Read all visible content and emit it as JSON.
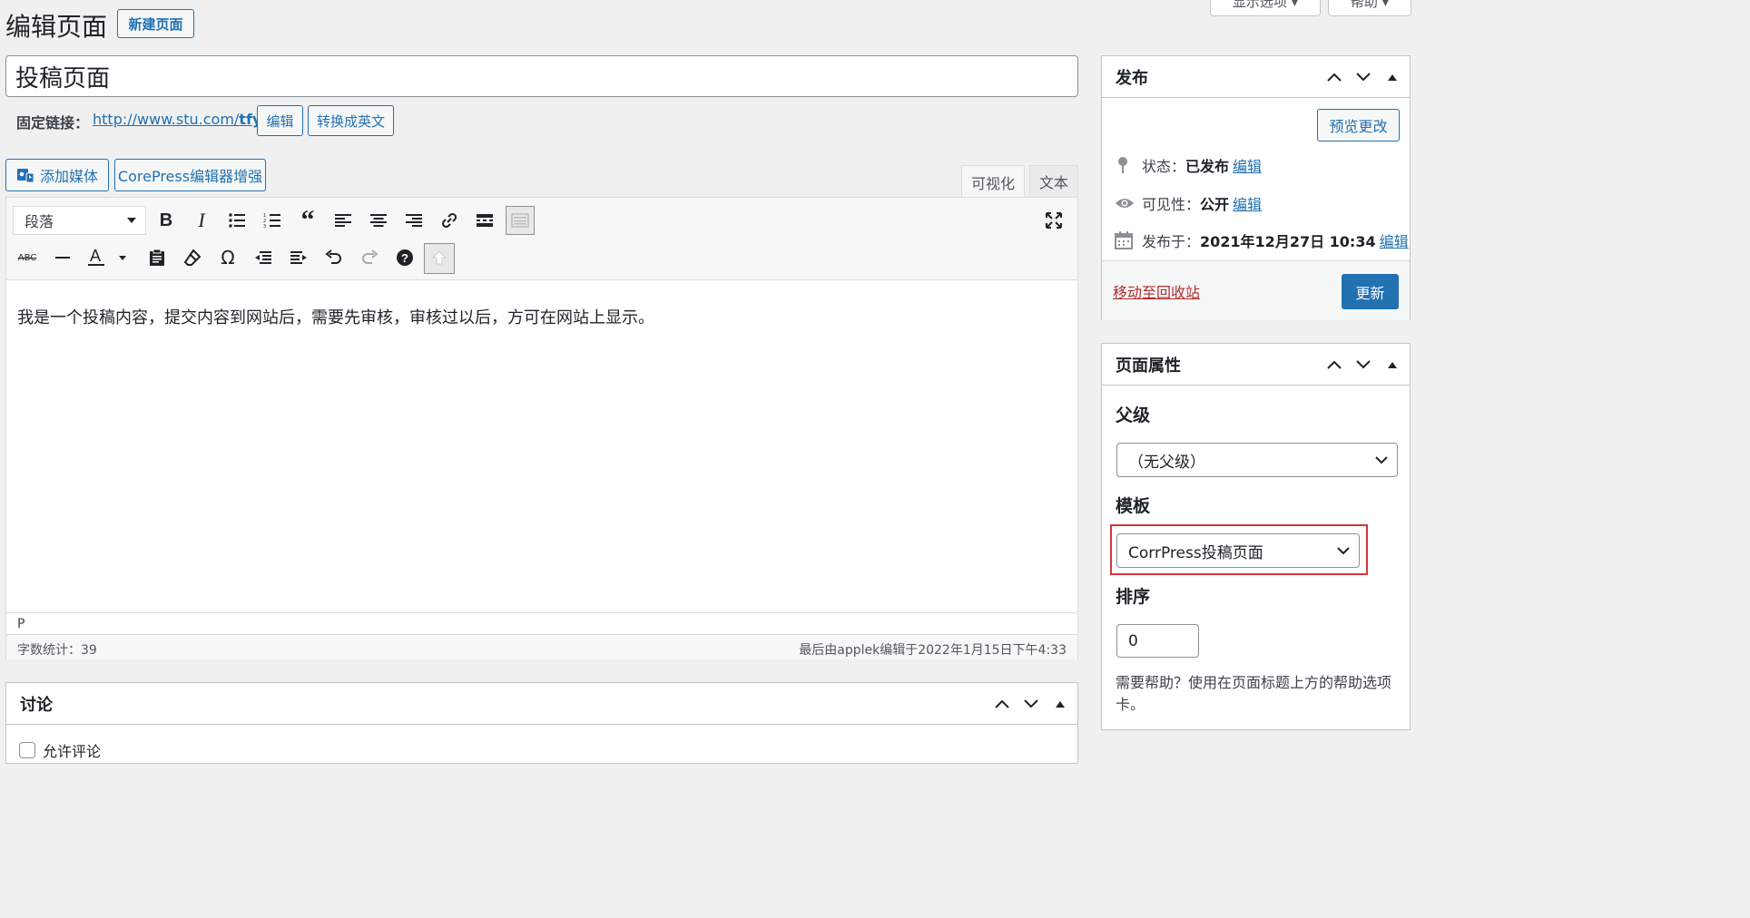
{
  "header": {
    "title": "编辑页面",
    "new_page_button": "新建页面",
    "screen_options": "显示选项 ▾",
    "help": "帮助 ▾"
  },
  "post": {
    "title_value": "投稿页面",
    "permalink_label": "固定链接：",
    "permalink_base": "http://www.stu.com/",
    "permalink_slug": "tfym",
    "edit_slug_button": "编辑",
    "translate_button": "转换成英文"
  },
  "editor": {
    "add_media_button": "添加媒体",
    "corepress_button": "CorePress编辑器增强",
    "tab_visual": "可视化",
    "tab_text": "文本",
    "format_select": "段落",
    "content": "我是一个投稿内容，提交内容到网站后，需要先审核，审核过以后，方可在网站上显示。",
    "path": "P",
    "word_count": "字数统计：39",
    "last_edited": "最后由applek编辑于2022年1月15日下午4:33"
  },
  "discussion": {
    "title": "讨论",
    "option_label": "允许评论"
  },
  "publish": {
    "title": "发布",
    "preview_button": "预览更改",
    "status_label": "状态：",
    "status_value": "已发布",
    "status_edit": "编辑",
    "visibility_label": "可见性：",
    "visibility_value": "公开",
    "visibility_edit": "编辑",
    "published_label": "发布于：",
    "published_value": "2021年12月27日 10:34",
    "published_edit": "编辑",
    "trash_link": "移动至回收站",
    "update_button": "更新"
  },
  "page_attributes": {
    "title": "页面属性",
    "parent_label": "父级",
    "parent_value": "（无父级）",
    "template_label": "模板",
    "template_value": "CorrPress投稿页面",
    "order_label": "排序",
    "order_value": "0",
    "help_text": "需要帮助？使用在页面标题上方的帮助选项卡。"
  },
  "colors": {
    "accent": "#2271b1",
    "highlight_box": "#d63638",
    "trash": "#b32d2e",
    "background": "#f0f0f1"
  }
}
